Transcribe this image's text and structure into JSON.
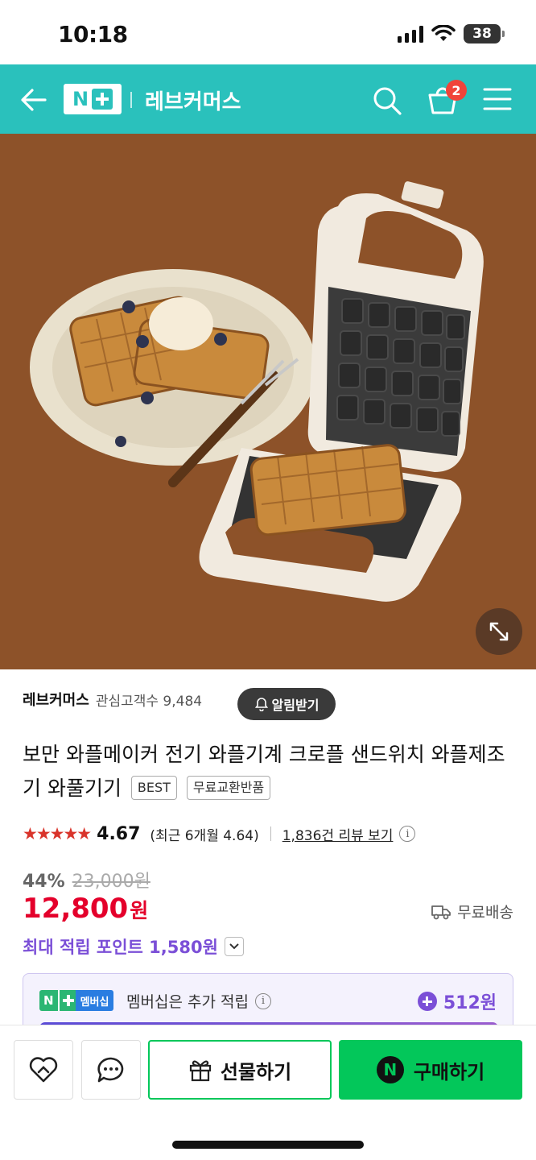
{
  "status_bar": {
    "time": "10:18",
    "battery": "38"
  },
  "header": {
    "store_name": "레브커머스",
    "cart_count": "2",
    "logo_letter": "N"
  },
  "gallery": {
    "dot_count": 9,
    "active_index": 0
  },
  "store": {
    "seller": "레브커머스",
    "fans": "관심고객수 9,484",
    "notify_label": "알림받기"
  },
  "product": {
    "title": "보만 와플메이커 전기 와플기계 크로플 샌드위치 와플제조기 와풀기기",
    "tags": [
      "BEST",
      "무료교환반품"
    ]
  },
  "rating": {
    "stars": "★★★★★",
    "value": "4.67",
    "recent": "(최근 6개월 4.64)",
    "reviews_link": "1,836건 리뷰 보기",
    "info": "i"
  },
  "price": {
    "discount": "44%",
    "original": "23,000원",
    "sale": "12,800",
    "currency": "원",
    "shipping": "무료배송",
    "points": "최대 적립 포인트 1,580원"
  },
  "membership": {
    "badge_n": "N",
    "badge_label": "멤버십",
    "text": "멤버십은 추가 적립",
    "info": "i",
    "points": "512원"
  },
  "bottom": {
    "gift_label": "선물하기",
    "buy_label": "구매하기",
    "npay_letter": "N"
  },
  "colors": {
    "header": "#2ac1bc",
    "price": "#e4002b",
    "points": "#7b4fd7",
    "buy": "#03c75a",
    "hero_bg": "#8d5229"
  }
}
